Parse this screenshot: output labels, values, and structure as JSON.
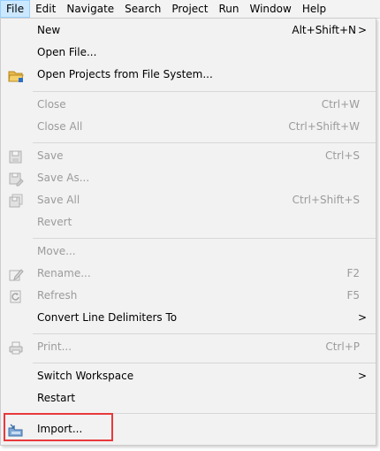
{
  "menubar": {
    "items": [
      "File",
      "Edit",
      "Navigate",
      "Search",
      "Project",
      "Run",
      "Window",
      "Help"
    ]
  },
  "menu": {
    "new": {
      "label": "New",
      "accel": "Alt+Shift+N",
      "arrow": ">"
    },
    "open_file": {
      "label": "Open File..."
    },
    "open_projects": {
      "label": "Open Projects from File System..."
    },
    "close": {
      "label": "Close",
      "accel": "Ctrl+W"
    },
    "close_all": {
      "label": "Close All",
      "accel": "Ctrl+Shift+W"
    },
    "save": {
      "label": "Save",
      "accel": "Ctrl+S"
    },
    "save_as": {
      "label": "Save As..."
    },
    "save_all": {
      "label": "Save All",
      "accel": "Ctrl+Shift+S"
    },
    "revert": {
      "label": "Revert"
    },
    "move": {
      "label": "Move..."
    },
    "rename": {
      "label": "Rename...",
      "accel": "F2"
    },
    "refresh": {
      "label": "Refresh",
      "accel": "F5"
    },
    "convert": {
      "label": "Convert Line Delimiters To",
      "arrow": ">"
    },
    "print": {
      "label": "Print...",
      "accel": "Ctrl+P"
    },
    "switch_workspace": {
      "label": "Switch Workspace",
      "arrow": ">"
    },
    "restart": {
      "label": "Restart"
    },
    "import": {
      "label": "Import..."
    }
  },
  "colors": {
    "highlight_border": "#e8393b",
    "active_menu_bg": "#cce8ff",
    "disabled_text": "#9b9b9b"
  }
}
